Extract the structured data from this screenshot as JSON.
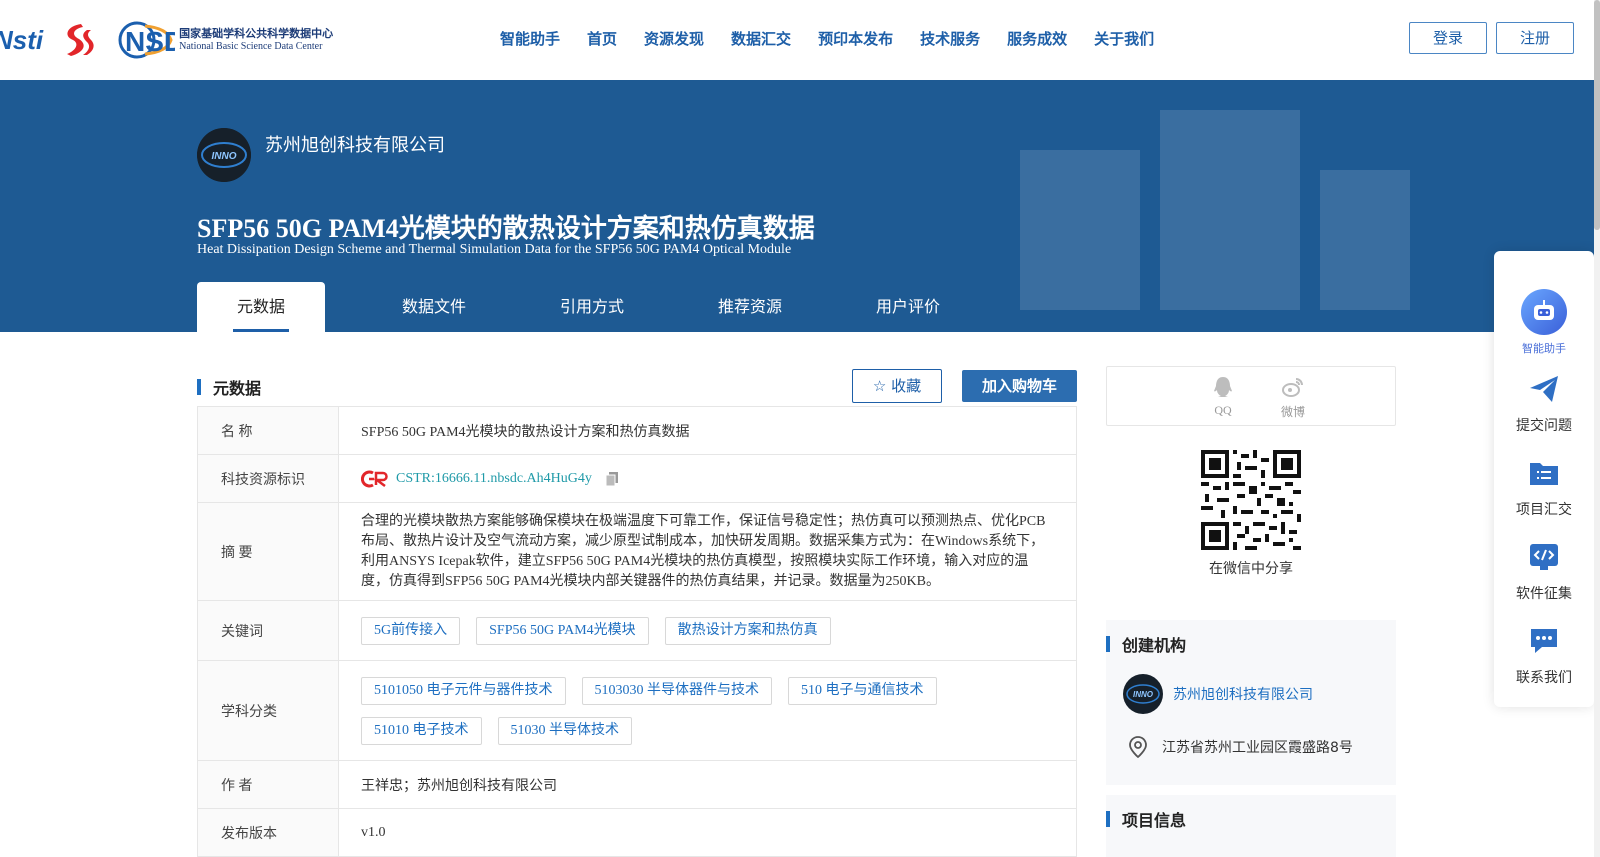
{
  "header": {
    "logo_nsti": "Nsti",
    "nsdc_mark": "NSDC",
    "nsdc_cn": "国家基础学科公共科学数据中心",
    "nsdc_en": "National Basic Science Data Center",
    "nav": [
      "智能助手",
      "首页",
      "资源发现",
      "数据汇交",
      "预印本发布",
      "技术服务",
      "服务成效",
      "关于我们"
    ],
    "login": "登录",
    "register": "注册"
  },
  "banner": {
    "org_name": "苏州旭创科技有限公司",
    "title_cn": "SFP56 50G PAM4光模块的散热设计方案和热仿真数据",
    "title_en": "Heat Dissipation Design Scheme and Thermal Simulation Data for the SFP56 50G PAM4 Optical Module",
    "tabs": [
      "元数据",
      "数据文件",
      "引用方式",
      "推荐资源",
      "用户评价"
    ]
  },
  "metadata": {
    "section_title": "元数据",
    "favorite": "收藏",
    "add_cart": "加入购物车",
    "rows": {
      "name_label": "名 称",
      "name_value": "SFP56 50G PAM4光模块的散热设计方案和热仿真数据",
      "id_label": "科技资源标识",
      "id_value": "CSTR:16666.11.nbsdc.Ah4HuG4y",
      "abstract_label": "摘 要",
      "abstract_value": "合理的光模块散热方案能够确保模块在极端温度下可靠工作，保证信号稳定性；热仿真可以预测热点、优化PCB布局、散热片设计及空气流动方案，减少原型试制成本，加快研发周期。数据采集方式为：在Windows系统下，利用ANSYS Icepak软件，建立SFP56 50G PAM4光模块的热仿真模型，按照模块实际工作环境，输入对应的温度，仿真得到SFP56 50G PAM4光模块内部关键器件的热仿真结果，并记录。数据量为250KB。",
      "keywords_label": "关键词",
      "keywords": [
        "5G前传接入",
        "SFP56 50G PAM4光模块",
        "散热设计方案和热仿真"
      ],
      "subject_label": "学科分类",
      "subjects": [
        "5101050 电子元件与器件技术",
        "5103030 半导体器件与技术",
        "510 电子与通信技术",
        "51010 电子技术",
        "51030 半导体技术"
      ],
      "author_label": "作 者",
      "author_value": "王祥忠；苏州旭创科技有限公司",
      "version_label": "发布版本",
      "version_value": "v1.0"
    }
  },
  "share": {
    "qq": "QQ",
    "weibo": "微博",
    "wechat": "在微信中分享"
  },
  "institution": {
    "title": "创建机构",
    "name": "苏州旭创科技有限公司",
    "address": "江苏省苏州工业园区霞盛路8号"
  },
  "project": {
    "title": "项目信息"
  },
  "float_bar": [
    "智能助手",
    "提交问题",
    "项目汇交",
    "软件征集",
    "联系我们"
  ],
  "colors": {
    "brand_blue": "#1e5fa8",
    "banner_blue": "#1e5a93",
    "link_teal": "#1f9aa8"
  }
}
